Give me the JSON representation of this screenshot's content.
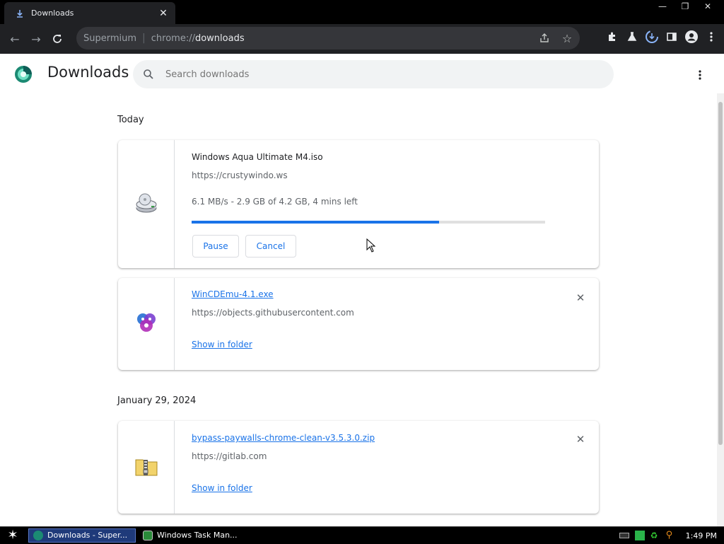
{
  "tab": {
    "title": "Downloads",
    "icon": "download-icon"
  },
  "window_controls": [
    "minimize-icon",
    "restore-icon",
    "close-icon"
  ],
  "omnibox": {
    "site": "Supermium",
    "scheme": "chrome://",
    "host": "downloads"
  },
  "page": {
    "title": "Downloads",
    "search_placeholder": "Search downloads"
  },
  "groups": [
    {
      "date": "Today",
      "items": [
        {
          "filename": "Windows Aqua Ultimate M4.iso",
          "source": "https://crustywindo.ws",
          "status": "6.1 MB/s - 2.9 GB of 4.2 GB, 4 mins left",
          "progress": 0.7,
          "pause_label": "Pause",
          "cancel_label": "Cancel"
        },
        {
          "filename": "WinCDEmu-4.1.exe",
          "source": "https://objects.githubusercontent.com",
          "action_label": "Show in folder"
        }
      ]
    },
    {
      "date": "January 29, 2024",
      "items": [
        {
          "filename": "bypass-paywalls-chrome-clean-v3.5.3.0.zip",
          "source": "https://gitlab.com",
          "action_label": "Show in folder"
        }
      ]
    }
  ],
  "taskbar": {
    "items": [
      {
        "label": "Downloads - Super..."
      },
      {
        "label": "Windows Task Man..."
      }
    ],
    "clock": "1:49 PM"
  },
  "colors": {
    "accent": "#1a73e8",
    "chrome_dark": "#202124",
    "taskbar_active": "#1f3a7a"
  }
}
